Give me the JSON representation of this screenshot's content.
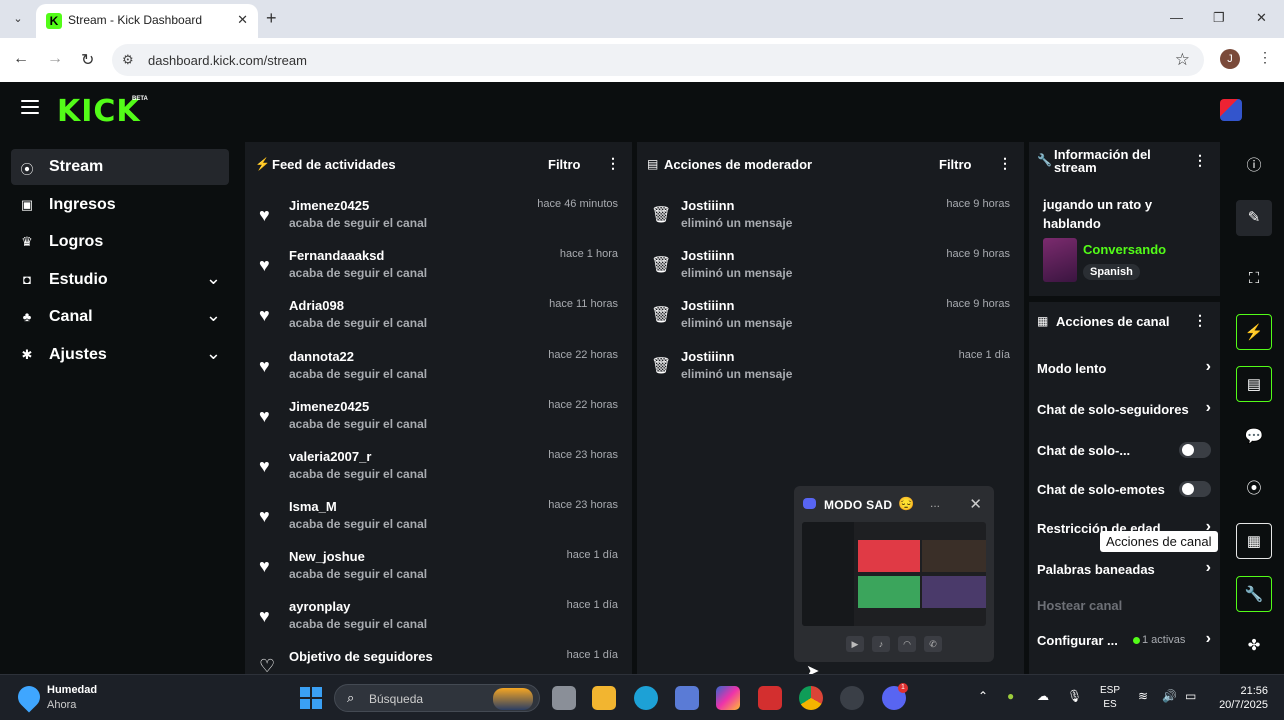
{
  "browser": {
    "tab_title": "Stream - Kick Dashboard",
    "url": "dashboard.kick.com/stream",
    "profile_initial": "J"
  },
  "app": {
    "logo": "KICK",
    "logo_badge": "BETA"
  },
  "sidebar": {
    "items": [
      {
        "label": "Stream",
        "icon": "broadcast-icon",
        "active": true,
        "expandable": false
      },
      {
        "label": "Ingresos",
        "icon": "bar-chart-icon",
        "expandable": false
      },
      {
        "label": "Logros",
        "icon": "trophy-icon",
        "expandable": false
      },
      {
        "label": "Estudio",
        "icon": "studio-icon",
        "expandable": true
      },
      {
        "label": "Canal",
        "icon": "users-icon",
        "expandable": true
      },
      {
        "label": "Ajustes",
        "icon": "gear-icon",
        "expandable": true
      }
    ]
  },
  "activity_feed": {
    "title": "Feed de actividades",
    "filter_label": "Filtro",
    "items": [
      {
        "name": "Jimenez0425",
        "action": "acaba de seguir el canal",
        "time": "hace 46 minutos"
      },
      {
        "name": "Fernandaaaksd",
        "action": "acaba de seguir el canal",
        "time": "hace 1 hora"
      },
      {
        "name": "Adria098",
        "action": "acaba de seguir el canal",
        "time": "hace 11 horas"
      },
      {
        "name": "dannota22",
        "action": "acaba de seguir el canal",
        "time": "hace 22 horas"
      },
      {
        "name": "Jimenez0425",
        "action": "acaba de seguir el canal",
        "time": "hace 22 horas"
      },
      {
        "name": "valeria2007_r",
        "action": "acaba de seguir el canal",
        "time": "hace 23 horas"
      },
      {
        "name": "Isma_M",
        "action": "acaba de seguir el canal",
        "time": "hace 23 horas"
      },
      {
        "name": "New_joshue",
        "action": "acaba de seguir el canal",
        "time": "hace 1 día"
      },
      {
        "name": "ayronplay",
        "action": "acaba de seguir el canal",
        "time": "hace 1 día"
      },
      {
        "name": "Objetivo de seguidores",
        "action": "",
        "time": "hace 1 día"
      }
    ]
  },
  "mod_actions": {
    "title": "Acciones de moderador",
    "filter_label": "Filtro",
    "items": [
      {
        "name": "Jostiiinn",
        "action": "eliminó un mensaje",
        "time": "hace 9 horas"
      },
      {
        "name": "Jostiiinn",
        "action": "eliminó un mensaje",
        "time": "hace 9 horas"
      },
      {
        "name": "Jostiiinn",
        "action": "eliminó un mensaje",
        "time": "hace 9 horas"
      },
      {
        "name": "Jostiiinn",
        "action": "eliminó un mensaje",
        "time": "hace 1 día"
      }
    ]
  },
  "stream_info": {
    "title": "Información del stream",
    "stream_title": "jugando un rato y hablando",
    "category": "Conversando",
    "language": "Spanish"
  },
  "channel_actions": {
    "title": "Acciones de canal",
    "items": [
      {
        "label": "Modo lento",
        "control": "chevron"
      },
      {
        "label": "Chat de solo-seguidores",
        "control": "chevron"
      },
      {
        "label": "Chat de solo-...",
        "control": "toggle"
      },
      {
        "label": "Chat de solo-emotes",
        "control": "toggle"
      },
      {
        "label": "Restricción de edad",
        "control": "chevron"
      },
      {
        "label": "Palabras baneadas",
        "control": "chevron"
      },
      {
        "label": "Hostear canal",
        "control": "none",
        "disabled": true
      },
      {
        "label": "Configurar ...",
        "control": "chevron",
        "active_count": "1 activas"
      }
    ]
  },
  "tooltip": "Acciones de canal",
  "discord_popup": {
    "title": "MODO SAD",
    "more": "..."
  },
  "taskbar": {
    "weather_title": "Humedad",
    "weather_sub": "Ahora",
    "search_placeholder": "Búsqueda",
    "lang_line1": "ESP",
    "lang_line2": "ES",
    "time": "21:56",
    "date": "20/7/2025",
    "discord_badge": "1"
  },
  "colors": {
    "accent": "#53fc18",
    "panel": "#181b1f",
    "background": "#0b0e0f"
  }
}
